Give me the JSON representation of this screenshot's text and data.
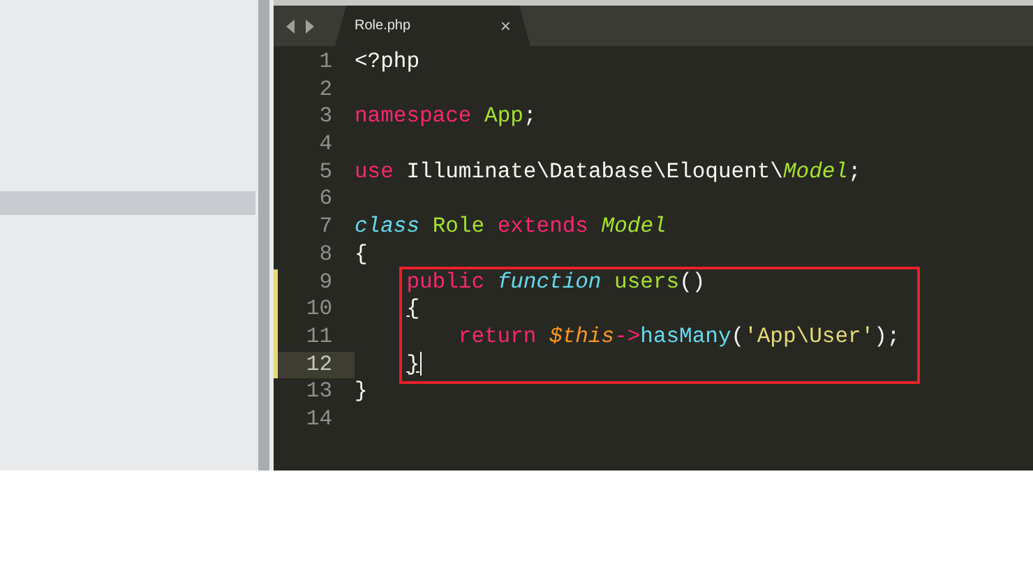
{
  "sidebar": {
    "rows": [
      {
        "selected": true
      }
    ]
  },
  "editor": {
    "tabs": [
      {
        "label": "Role.php",
        "close": "×",
        "selected": true
      }
    ],
    "lines": [
      {
        "number": "1",
        "modified": false,
        "current": false,
        "boxed": false,
        "tokens": [
          {
            "text": "<?php",
            "kind": "plain"
          }
        ]
      },
      {
        "number": "2",
        "modified": false,
        "current": false,
        "boxed": false
      },
      {
        "number": "3",
        "modified": false,
        "current": false,
        "boxed": false,
        "tokens": [
          {
            "text": "namespace",
            "kind": "keyword"
          },
          {
            "text": "App",
            "kind": "entity"
          },
          {
            "text": ";",
            "kind": "plain",
            "join": true
          }
        ]
      },
      {
        "number": "4",
        "modified": false,
        "current": false,
        "boxed": false
      },
      {
        "number": "5",
        "modified": false,
        "current": false,
        "boxed": false,
        "tokens": [
          {
            "text": "use",
            "kind": "keyword"
          },
          {
            "text": "Illuminate\\Database\\Eloquent\\",
            "kind": "plain"
          },
          {
            "text": "Model",
            "kind": "type",
            "join": true
          },
          {
            "text": ";",
            "kind": "plain",
            "join": true
          }
        ]
      },
      {
        "number": "6",
        "modified": false,
        "current": false,
        "boxed": false
      },
      {
        "number": "7",
        "modified": false,
        "current": false,
        "boxed": false,
        "tokens": [
          {
            "text": "class",
            "kind": "storage"
          },
          {
            "text": "Role",
            "kind": "entity"
          },
          {
            "text": "extends",
            "kind": "keyword"
          },
          {
            "text": "Model",
            "kind": "type"
          }
        ]
      },
      {
        "number": "8",
        "modified": false,
        "current": false,
        "boxed": false,
        "tokens": [
          {
            "text": "{",
            "kind": "plain"
          }
        ],
        "children": [
          {
            "number": "9",
            "modified": true,
            "current": false,
            "boxed": true,
            "tokens": [
              {
                "text": "public",
                "kind": "keyword"
              },
              {
                "text": "function",
                "kind": "storage"
              },
              {
                "text": "users",
                "kind": "entity"
              },
              {
                "text": "()",
                "kind": "plain",
                "join": true
              }
            ]
          },
          {
            "number": "10",
            "modified": true,
            "current": false,
            "boxed": true,
            "tokens": [
              {
                "text": "{",
                "kind": "plain",
                "matched": true
              }
            ],
            "children": [
              {
                "number": "11",
                "modified": true,
                "current": false,
                "boxed": true,
                "tokens": [
                  {
                    "text": "return",
                    "kind": "keyword"
                  },
                  {
                    "text": "$this",
                    "kind": "variable"
                  },
                  {
                    "text": "->",
                    "kind": "keyword",
                    "join": true
                  },
                  {
                    "text": "hasMany",
                    "kind": "function",
                    "join": true
                  },
                  {
                    "text": "(",
                    "kind": "plain",
                    "join": true
                  },
                  {
                    "text": "'App\\User'",
                    "kind": "string",
                    "join": true
                  },
                  {
                    "text": ");",
                    "kind": "plain",
                    "join": true
                  }
                ]
              }
            ]
          },
          {
            "number": "12",
            "modified": true,
            "current": true,
            "boxed": true,
            "tokens": [
              {
                "text": "}",
                "kind": "plain",
                "matched": true
              }
            ]
          }
        ]
      },
      {
        "number": "13",
        "modified": false,
        "current": false,
        "boxed": false,
        "tokens": [
          {
            "text": "}",
            "kind": "plain"
          }
        ]
      },
      {
        "number": "14",
        "modified": false,
        "current": false,
        "boxed": false
      }
    ]
  }
}
